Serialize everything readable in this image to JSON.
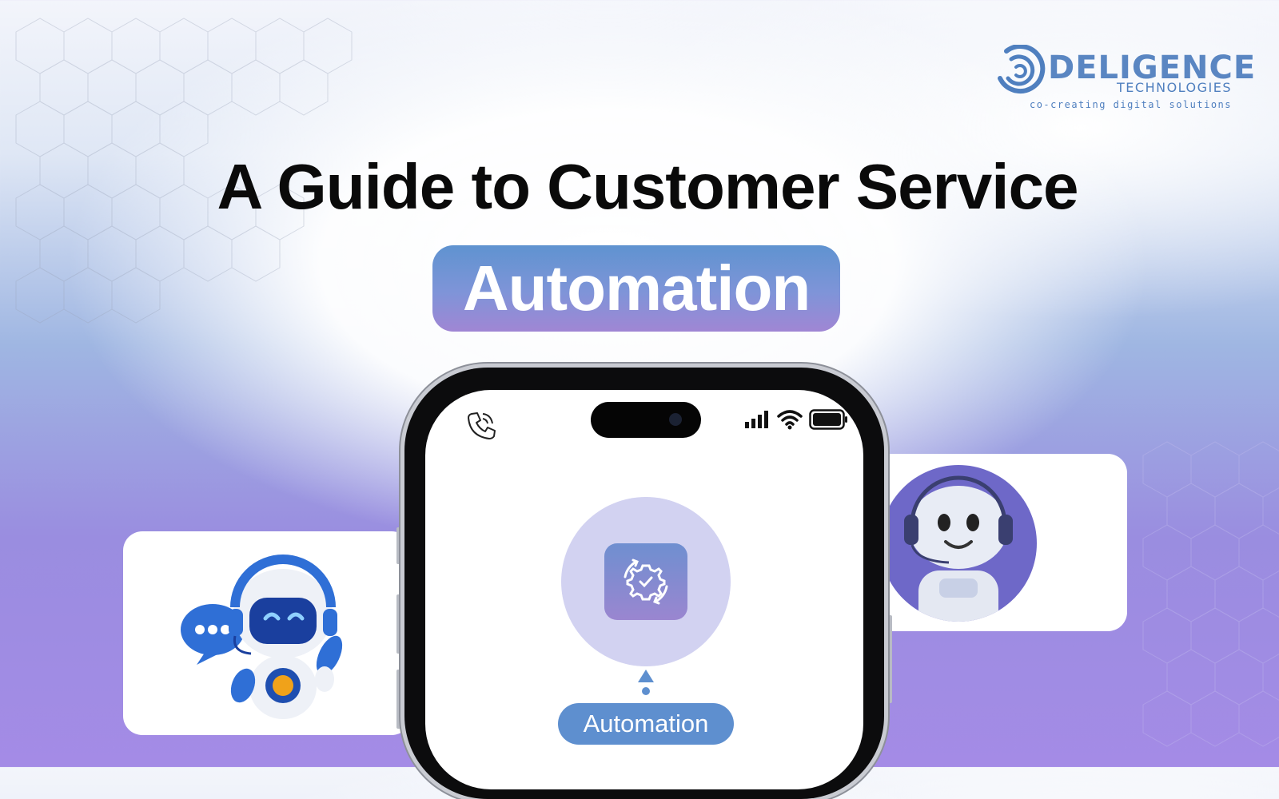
{
  "brand": {
    "name": "DELIGENCE",
    "sub": "TECHNOLOGIES",
    "tagline": "co-creating digital solutions"
  },
  "headline": {
    "title": "A Guide to Customer Service",
    "highlight": "Automation"
  },
  "phone": {
    "chip_label": "Automation",
    "status_icons": [
      "phone-call-icon",
      "signal-bars-icon",
      "wifi-icon",
      "battery-icon"
    ],
    "center_icon": "gear-check-icon"
  },
  "illustrations": [
    "chatbot-robot-icon",
    "support-robot-avatar-icon"
  ],
  "colors": {
    "accent_blue": "#5e8fcf",
    "accent_purple": "#a086d4",
    "title": "#0a0a0a"
  }
}
